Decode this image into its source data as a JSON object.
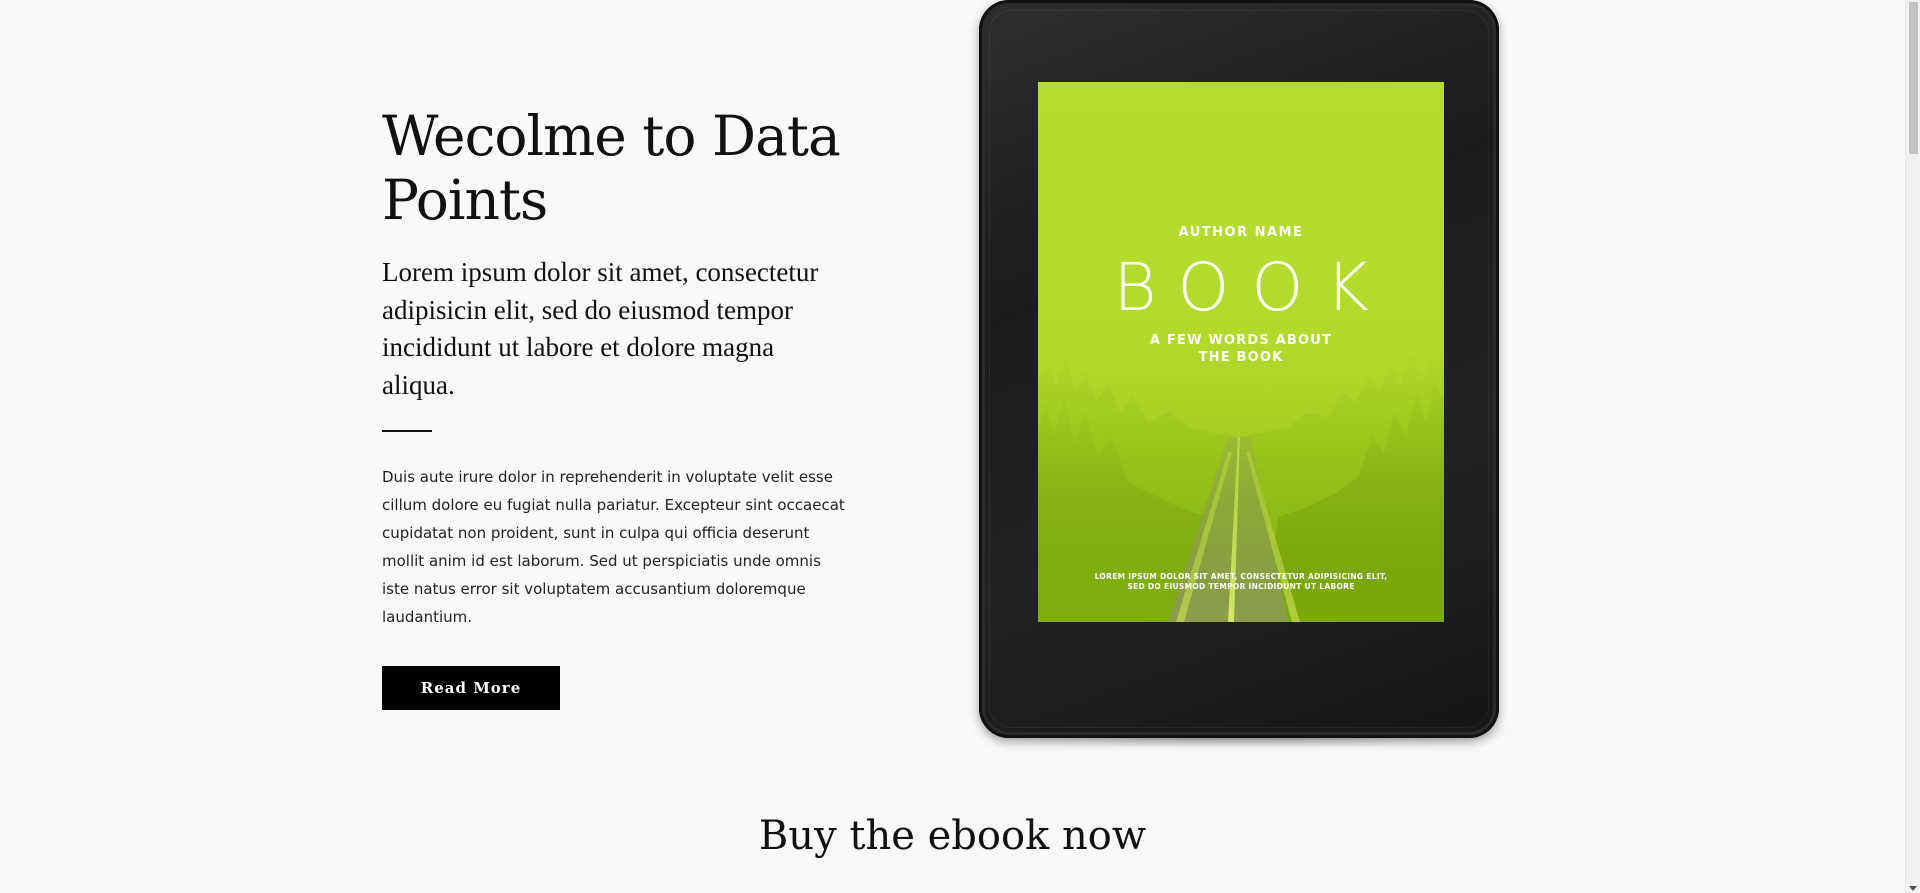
{
  "hero": {
    "title_line1": "Wecolme to Data",
    "title_line2": "Points",
    "lead": "Lorem ipsum dolor sit amet, consectetur adipisicin elit, sed do eiusmod tempor incididunt ut labore et dolore magna aliqua.",
    "body": "Duis aute irure dolor in reprehenderit in voluptate velit esse cillum dolore eu fugiat nulla pariatur. Excepteur sint occaecat cupidatat non proident, sunt in culpa qui officia deserunt mollit anim id est laborum. Sed ut perspiciatis unde omnis iste natus error sit voluptatem accusantium doloremque laudantium.",
    "button_label": "Read More"
  },
  "ebook": {
    "author": "AUTHOR NAME",
    "title": "BOOK",
    "subtitle_line1": "A FEW WORDS ABOUT",
    "subtitle_line2": "THE BOOK",
    "footer_line1": "LOREM IPSUM DOLOR SIT AMET, CONSECTETUR ADIPISICING ELIT,",
    "footer_line2": "SED DO EIUSMOD TEMPOR INCIDIDUNT UT LABORE",
    "cover_color": "#b5dd2e"
  },
  "section": {
    "title": "Buy the ebook now",
    "subtitle": ""
  }
}
